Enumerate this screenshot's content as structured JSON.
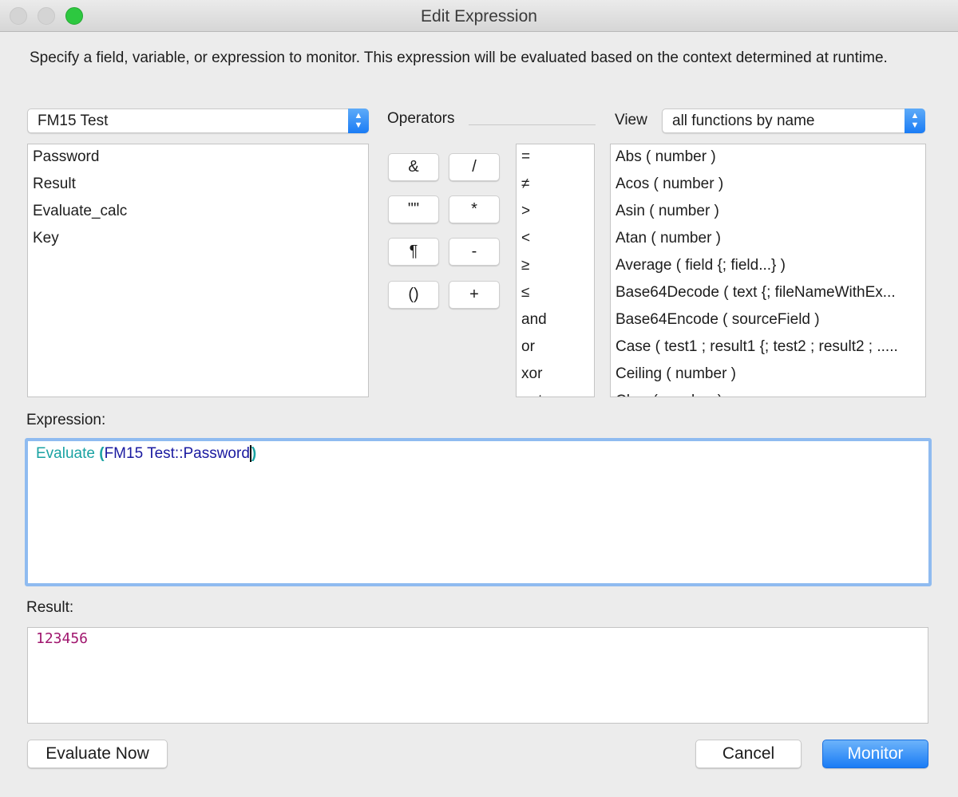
{
  "window": {
    "title": "Edit Expression"
  },
  "description": "Specify a field, variable, or expression to monitor. This expression will be evaluated based on the context determined at runtime.",
  "table_select": {
    "value": "FM15 Test"
  },
  "fields": [
    "Password",
    "Result",
    "Evaluate_calc",
    "Key"
  ],
  "operators": {
    "label": "Operators",
    "buttons": [
      "&",
      "/",
      "\"\"",
      "*",
      "¶",
      "-",
      "()",
      "+"
    ],
    "list": [
      "=",
      "≠",
      ">",
      "<",
      "≥",
      "≤",
      "and",
      "or",
      "xor",
      "not"
    ]
  },
  "view": {
    "label": "View",
    "value": "all functions by name"
  },
  "functions": [
    "Abs ( number )",
    "Acos ( number )",
    "Asin ( number )",
    "Atan ( number )",
    "Average ( field {; field...} )",
    "Base64Decode ( text {; fileNameWithEx...",
    "Base64Encode ( sourceField )",
    "Case ( test1 ; result1 {; test2 ; result2 ; .....",
    "Ceiling ( number )",
    "Char ( number )"
  ],
  "expression": {
    "label": "Expression:",
    "function": "Evaluate",
    "open": " (",
    "field": "FM15 Test::Password",
    "close": ")"
  },
  "result": {
    "label": "Result:",
    "value": "123456"
  },
  "buttons": {
    "evaluate_now": "Evaluate Now",
    "cancel": "Cancel",
    "monitor": "Monitor"
  },
  "colors": {
    "function": "#1aa3a3",
    "field": "#1a1aa0",
    "result": "#a0166e",
    "accent": "#1a7cf5"
  }
}
